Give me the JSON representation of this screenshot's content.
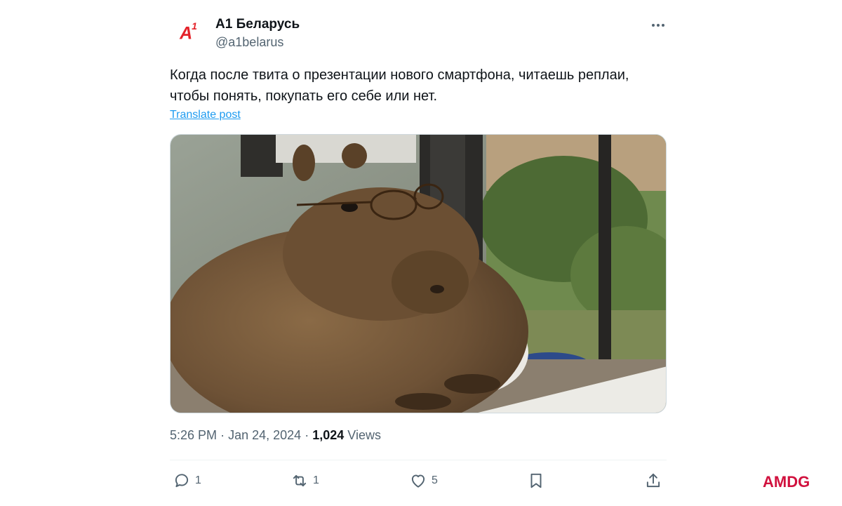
{
  "account": {
    "display_name": "A1 Беларусь",
    "handle": "@a1belarus",
    "avatar_logo": "A",
    "avatar_logo_sup": "1",
    "avatar_color": "#e4222a"
  },
  "tweet": {
    "text": "Когда после твита о презентации нового смартфона, читаешь реплаи, чтобы понять, покупать его себе или нет.",
    "translate_label": "Translate post",
    "time": "5:26 PM",
    "date": "Jan 24, 2024",
    "views_count": "1,024",
    "views_label": "Views",
    "separator": "·"
  },
  "actions": {
    "reply_count": "1",
    "retweet_count": "1",
    "like_count": "5"
  },
  "watermark": {
    "text": "AMDG",
    "color": "#d1113e"
  },
  "icons": {
    "more": "more-horizontal-icon",
    "reply": "reply-icon",
    "retweet": "retweet-icon",
    "like": "heart-icon",
    "bookmark": "bookmark-icon",
    "share": "share-icon"
  },
  "colors": {
    "link": "#1d9bf0",
    "secondary_text": "#536471",
    "primary_text": "#0f1419"
  }
}
